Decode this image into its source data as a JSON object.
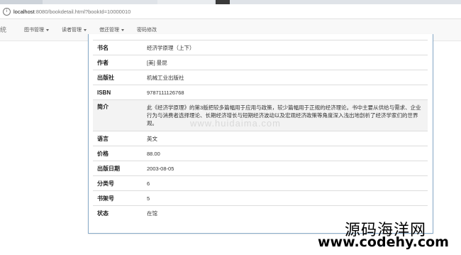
{
  "browser": {
    "url_host": "localhost",
    "url_rest": ":8080/bookdetail.html?bookId=10000010"
  },
  "navbar": {
    "brand": "统",
    "menus": [
      {
        "label": "图书管理",
        "has_dropdown": true
      },
      {
        "label": "读者管理",
        "has_dropdown": true
      },
      {
        "label": "借还管理",
        "has_dropdown": true
      },
      {
        "label": "密码修改",
        "has_dropdown": false
      }
    ]
  },
  "book": {
    "rows": [
      {
        "label": "书名",
        "value": "经济学原理（上下）"
      },
      {
        "label": "作者",
        "value": "[美] 曼昆"
      },
      {
        "label": "出版社",
        "value": "机械工业出版社"
      },
      {
        "label": "ISBN",
        "value": "9787111126768"
      },
      {
        "label": "简介",
        "value": "此《经济学原理》的第3版把较多篇幅用于应用与政策，较少篇幅用于正规的经济理论。书中主要从供给与需求、企业行为与消费者选择理论、长期经济增长与短期经济波动以及宏观经济政策等角度深入浅出地剖析了经济学家们的世界观。"
      },
      {
        "label": "语言",
        "value": "英文"
      },
      {
        "label": "价格",
        "value": "88.00"
      },
      {
        "label": "出版日期",
        "value": "2003-08-05"
      },
      {
        "label": "分类号",
        "value": "6"
      },
      {
        "label": "书架号",
        "value": "5"
      },
      {
        "label": "状态",
        "value": "在馆"
      }
    ]
  },
  "watermarks": {
    "mid": "www.huidaima.com",
    "cn": "源码海洋网",
    "url": "www.codehy.com"
  }
}
